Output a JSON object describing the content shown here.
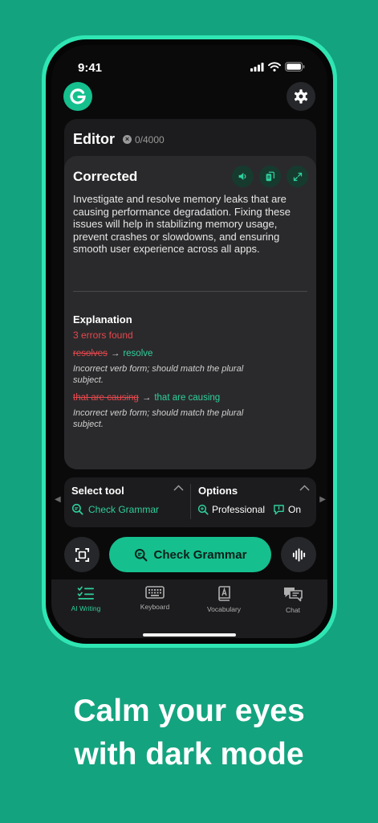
{
  "status_bar": {
    "time": "9:41"
  },
  "editor": {
    "title": "Editor",
    "char_count": "0/4000",
    "corrected_title": "Corrected",
    "corrected_text": "Investigate and resolve memory leaks that are causing performance degradation. Fixing these issues will help in stabilizing memory usage, prevent crashes or slowdowns, and ensuring smooth user experience across all apps."
  },
  "explanation": {
    "title": "Explanation",
    "errors_found": "3 errors found",
    "corrections": [
      {
        "original": "resolves",
        "arrow": "→",
        "corrected": "resolve",
        "reason": "Incorrect verb form; should match the plural subject."
      },
      {
        "original": "that are causing",
        "arrow": "→",
        "corrected": "that are causing",
        "reason": "Incorrect verb form; should match the plural subject."
      }
    ]
  },
  "tool_panel": {
    "select_tool_label": "Select tool",
    "selected_tool": "Check Grammar",
    "options_label": "Options",
    "tone": "Professional",
    "explanations_state": "On"
  },
  "actions": {
    "check_button": "Check Grammar"
  },
  "tabs": [
    {
      "label": "AI Writing",
      "icon": "ai-writing-icon",
      "active": true
    },
    {
      "label": "Keyboard",
      "icon": "keyboard-icon",
      "active": false
    },
    {
      "label": "Vocabulary",
      "icon": "vocabulary-icon",
      "active": false
    },
    {
      "label": "Chat",
      "icon": "chat-icon",
      "active": false
    }
  ],
  "marketing": {
    "line1": "Calm your eyes",
    "line2": "with dark mode"
  },
  "colors": {
    "background": "#14a37f",
    "phone_frame": "#2fe6b3",
    "accent": "#15c08e",
    "error": "#e5484d",
    "correct": "#2fcf9c"
  }
}
